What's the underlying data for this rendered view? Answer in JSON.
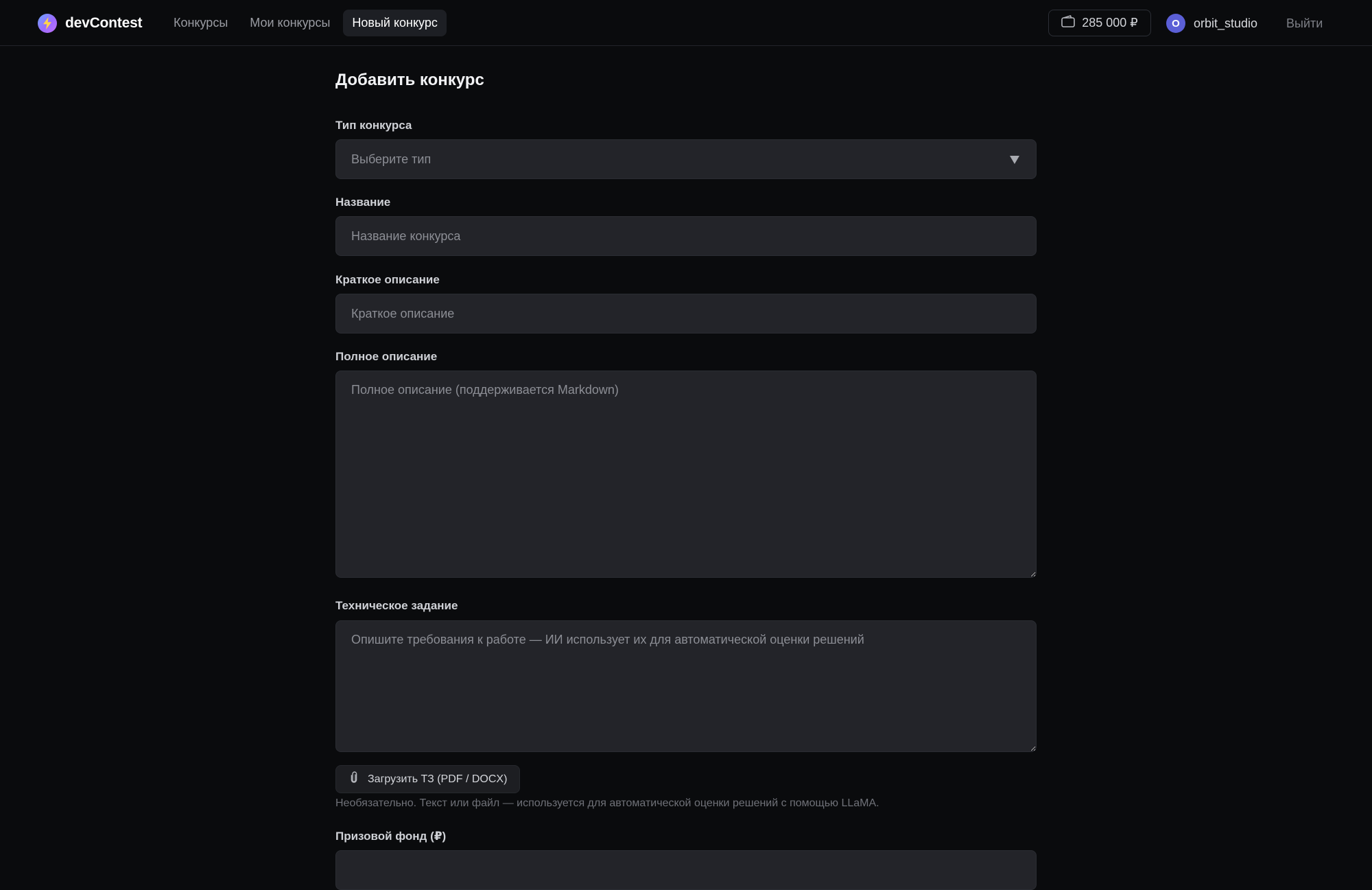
{
  "brand": {
    "name": "devContest",
    "logo_icon": "lightning-icon"
  },
  "nav": {
    "items": [
      {
        "label": "Конкурсы"
      },
      {
        "label": "Мои конкурсы"
      },
      {
        "label": "Новый конкурс",
        "active": true
      }
    ]
  },
  "header": {
    "balance": "285 000 ₽",
    "balance_icon": "wallet-icon",
    "avatar_letter": "O",
    "username": "orbit_studio",
    "logout": "Выйти"
  },
  "form": {
    "title": "Добавить конкурс",
    "type": {
      "label": "Тип конкурса",
      "placeholder": "Выберите тип"
    },
    "name": {
      "label": "Название",
      "placeholder": "Название конкурса",
      "value": ""
    },
    "short_description": {
      "label": "Краткое описание",
      "placeholder": "Краткое описание",
      "value": ""
    },
    "full_description": {
      "label": "Полное описание",
      "placeholder": "Полное описание (поддерживается Markdown)",
      "value": ""
    },
    "spec": {
      "label": "Техническое задание",
      "placeholder": "Опишите требования к работе — ИИ использует их для автоматической оценки решений",
      "value": "",
      "upload_label": "Загрузить ТЗ (PDF / DOCX)",
      "upload_icon": "paperclip-icon",
      "hint": "Необязательно. Текст или файл — используется для автоматической оценки решений с помощью LLaMA."
    },
    "prize": {
      "label": "Призовой фонд (₽)",
      "value": ""
    }
  },
  "colors": {
    "background": "#0a0b0d",
    "field": "#232429",
    "avatar": "#5b5fd6",
    "active_nav": "#1d1f24"
  }
}
